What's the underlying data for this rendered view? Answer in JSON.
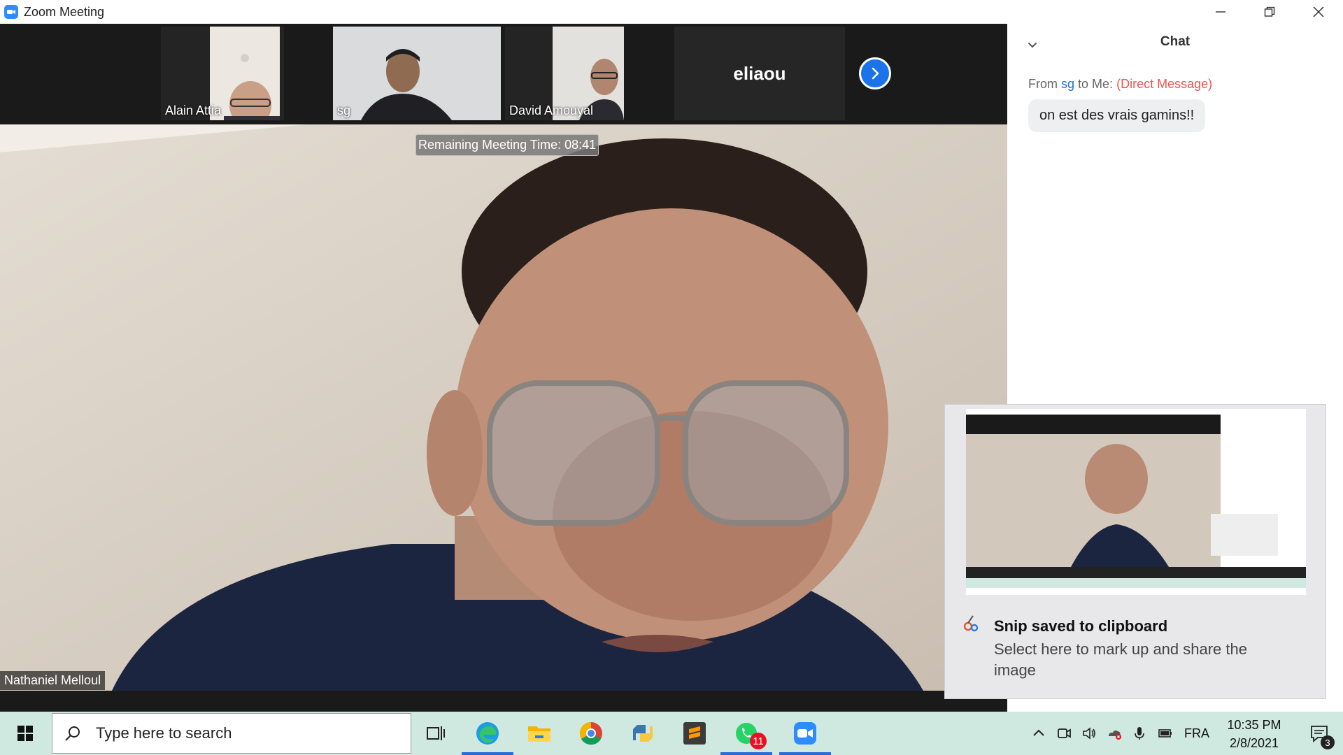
{
  "window": {
    "title": "Zoom Meeting",
    "icon": "zoom-icon",
    "controls": [
      "minimize-icon",
      "restore-icon",
      "close-icon"
    ]
  },
  "meeting": {
    "participants": [
      {
        "name": "Alain Attia",
        "type": "video"
      },
      {
        "name": "sg",
        "type": "video"
      },
      {
        "name": "David Amouyal",
        "type": "video"
      },
      {
        "name": "eliaou",
        "type": "avatar"
      }
    ],
    "next_icon": "chevron-right-icon",
    "timer_text": "Remaining Meeting Time: 08:41",
    "active_speaker": "Nathaniel Melloul"
  },
  "chat": {
    "title": "Chat",
    "collapse_icon": "chevron-down-icon",
    "message": {
      "from_prefix": "From",
      "sender": "sg",
      "to": "to Me:",
      "tag": "(Direct Message)",
      "text": "on est des vrais gamins!!"
    }
  },
  "toast": {
    "icon": "snip-icon",
    "title": "Snip saved to clipboard",
    "body": "Select here to mark up and share the image"
  },
  "taskbar": {
    "start_icon": "windows-icon",
    "search_placeholder": "Type here to search",
    "apps": [
      {
        "name": "task-view-icon",
        "active": false
      },
      {
        "name": "edge-icon",
        "active": true
      },
      {
        "name": "file-explorer-icon",
        "active": false
      },
      {
        "name": "chrome-icon",
        "active": false
      },
      {
        "name": "python-icon",
        "active": false
      },
      {
        "name": "sublime-icon",
        "active": false
      },
      {
        "name": "whatsapp-icon",
        "active": true,
        "badge": "11"
      },
      {
        "name": "zoom-icon",
        "active": true
      }
    ],
    "tray": {
      "language": "FRA",
      "time": "10:35 PM",
      "date": "2/8/2021",
      "notifications": "3"
    }
  },
  "colors": {
    "accent": "#2d8cff",
    "dm_red": "#e8554e",
    "taskbar": "#cfe8e0"
  }
}
